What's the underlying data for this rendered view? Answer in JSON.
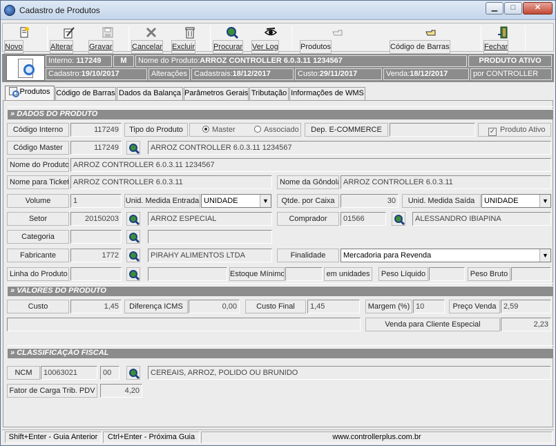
{
  "window": {
    "title": "Cadastro de Produtos",
    "min": "▁",
    "max": "□",
    "close": "✕"
  },
  "toolbar": {
    "novo": "Novo",
    "alterar": "Alterar",
    "gravar": "Gravar",
    "cancelar": "Cancelar",
    "excluir": "Excluir",
    "procurar": "Procurar",
    "ver_log": "Ver Log",
    "produtos": "Produtos",
    "codigo_barras": "Código de Barras",
    "fechar": "Fechar"
  },
  "info": {
    "interno_label": "Interno:",
    "interno_value": "117249",
    "m": "M",
    "nome_label": "Nome do Produto:",
    "nome_value": "ARROZ  CONTROLLER 6.0.3.11 1234567",
    "status": "PRODUTO ATIVO",
    "cadastro_label": "Cadastro:",
    "cadastro_value": "19/10/2017",
    "alteracoes": "Alterações",
    "cadastrais_label": "Cadastrais:",
    "cadastrais_value": "18/12/2017",
    "custo_label": "Custo:",
    "custo_value": "29/11/2017",
    "venda_label": "Venda:",
    "venda_value": "18/12/2017",
    "por": "por CONTROLLER"
  },
  "tabs": [
    "Produtos",
    "Código de Barras",
    "Dados da Balança",
    "Parâmetros Gerais",
    "Tributação",
    "Informações de WMS"
  ],
  "sections": {
    "dados": "DADOS DO PRODUTO",
    "valores": "VALORES DO PRODUTO",
    "fiscal": "CLASSIFICAÇÃO FISCAL"
  },
  "form": {
    "codigo_interno_label": "Código Interno",
    "codigo_interno": "117249",
    "tipo_produto_label": "Tipo do Produto",
    "master": "Master",
    "associado": "Associado",
    "dep_ecommerce_label": "Dep. E-COMMERCE",
    "dep_ecommerce": "",
    "produto_ativo_label": "Produto Ativo",
    "check_mark": "✓",
    "codigo_master_label": "Código Master",
    "codigo_master": "117249",
    "codigo_master_desc": "ARROZ  CONTROLLER 6.0.3.11 1234567",
    "nome_produto_label": "Nome do Produto",
    "nome_produto": "ARROZ  CONTROLLER 6.0.3.11 1234567",
    "nome_ticket_label": "Nome para Ticket",
    "nome_ticket": "ARROZ  CONTROLLER 6.0.3.11",
    "nome_gondola_label": "Nome da Gôndola",
    "nome_gondola": "ARROZ  CONTROLLER 6.0.3.11",
    "volume_label": "Volume",
    "volume": "1",
    "unid_entrada_label": "Unid. Medida Entrada",
    "unid_entrada": "UNIDADE",
    "qtde_caixa_label": "Qtde. por Caixa",
    "qtde_caixa": "30",
    "unid_saida_label": "Unid. Medida Saída",
    "unid_saida": "UNIDADE",
    "setor_label": "Setor",
    "setor": "20150203",
    "setor_desc": "ARROZ ESPECIAL",
    "comprador_label": "Comprador",
    "comprador": "01566",
    "comprador_desc": "ALESSANDRO IBIAPINA",
    "categoria_label": "Categoria",
    "categoria": "",
    "categoria_desc": "",
    "fabricante_label": "Fabricante",
    "fabricante": "1772",
    "fabricante_desc": "PIRAHY ALIMENTOS LTDA",
    "finalidade_label": "Finalidade",
    "finalidade": "Mercadoria para Revenda",
    "linha_label": "Linha do Produto",
    "linha": "",
    "linha_desc": "",
    "estoque_min_label": "Estoque Mínimo",
    "estoque_min": "",
    "em_unidades": "em unidades",
    "peso_liquido_label": "Peso Líquido",
    "peso_liquido": "",
    "peso_bruto_label": "Peso Bruto",
    "peso_bruto": "",
    "custo_label": "Custo",
    "custo": "1,45",
    "dif_icms_label": "Diferença ICMS",
    "dif_icms": "0,00",
    "custo_final_label": "Custo Final",
    "custo_final": "1,45",
    "margem_label": "Margem (%)",
    "margem": "10",
    "preco_venda_label": "Preço Venda",
    "preco_venda": "2,59",
    "venda_especial_label": "Venda para Cliente Especial",
    "venda_especial": "2,23",
    "ncm_label": "NCM",
    "ncm": "10063021",
    "ncm_ex": "00",
    "ncm_desc": "CEREAIS, ARROZ, POLIDO OU BRUNIDO",
    "fator_carga_label": "Fator de Carga Trib. PDV",
    "fator_carga": "4,20"
  },
  "status": {
    "anterior": "Shift+Enter - Guia Anterior",
    "proxima": "Ctrl+Enter - Próxima Guia",
    "site": "www.controllerplus.com.br"
  },
  "dropdown_arrow": "▼"
}
